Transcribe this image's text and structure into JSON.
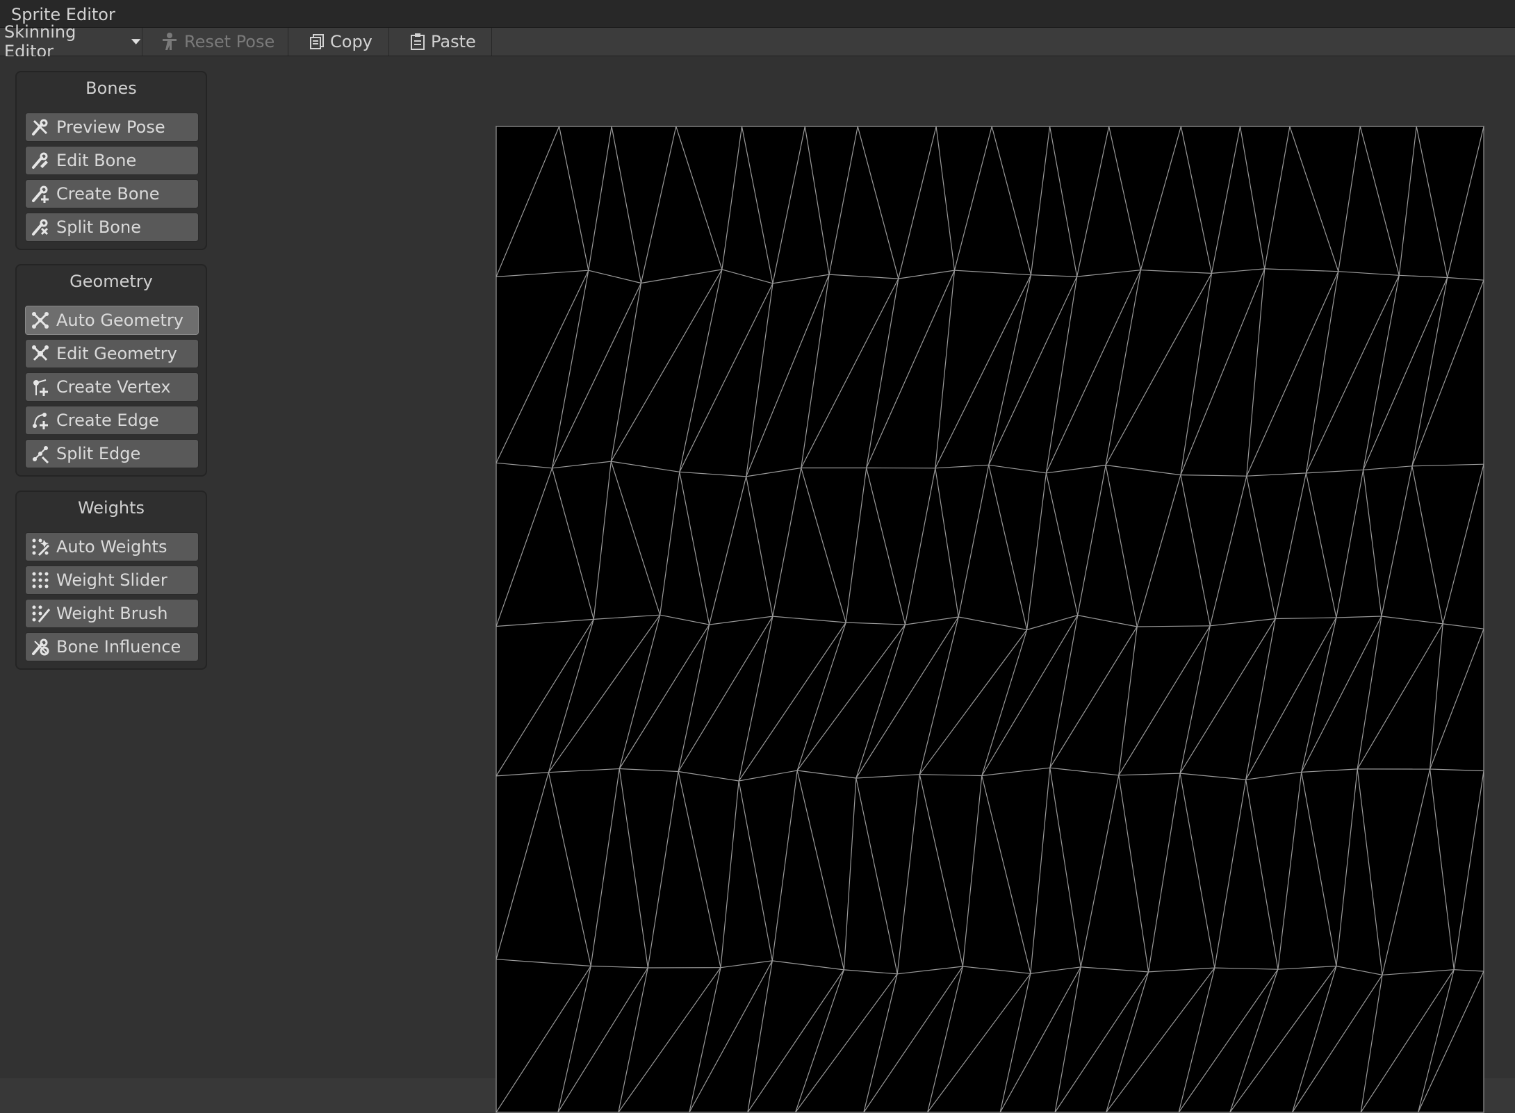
{
  "window": {
    "title": "Sprite Editor"
  },
  "toolbar": {
    "mode_label": "Skinning Editor",
    "reset_pose_label": "Reset Pose",
    "copy_label": "Copy",
    "paste_label": "Paste"
  },
  "panels": {
    "bones": {
      "title": "Bones",
      "items": [
        "Preview Pose",
        "Edit Bone",
        "Create Bone",
        "Split Bone"
      ]
    },
    "geometry": {
      "title": "Geometry",
      "items": [
        "Auto Geometry",
        "Edit Geometry",
        "Create Vertex",
        "Create Edge",
        "Split Edge"
      ]
    },
    "weights": {
      "title": "Weights",
      "items": [
        "Auto Weights",
        "Weight Slider",
        "Weight Brush",
        "Bone Influence"
      ]
    }
  },
  "colors": {
    "mesh_line": "#9a9a9a",
    "active_tool": "#6e6e6e"
  }
}
